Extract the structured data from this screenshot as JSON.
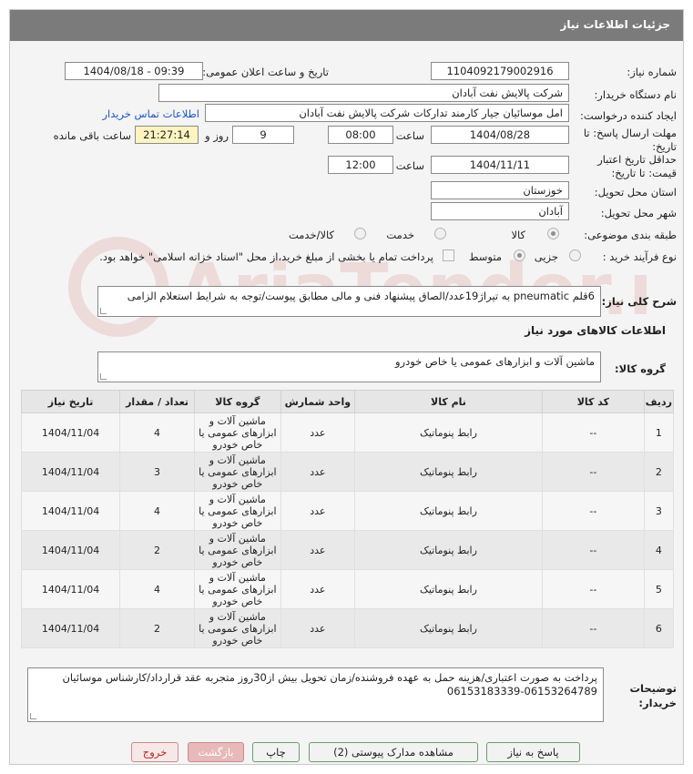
{
  "header": {
    "title": "جزئیات اطلاعات نیاز"
  },
  "form": {
    "need_number": {
      "label": "شماره نیاز:",
      "value": "1104092179002916"
    },
    "announce": {
      "label": "تاریخ و ساعت اعلان عمومی:",
      "value": "1404/08/18 - 09:39"
    },
    "buyer_org": {
      "label": "نام دستگاه خریدار:",
      "value": "شرکت پالایش نفت آبادان"
    },
    "creator": {
      "label": "ایجاد کننده درخواست:",
      "value": "امل موسائیان جیار کارمند تدارکات شرکت پالایش نفت آبادان",
      "contact_link": "اطلاعات تماس خریدار"
    },
    "deadline": {
      "label": "مهلت ارسال پاسخ: تا تاریخ:",
      "date": "1404/08/28",
      "time_label": "ساعت",
      "time": "08:00",
      "days": "9",
      "days_label": "روز و",
      "remaining": "21:27:14",
      "remaining_label": "ساعت باقی مانده"
    },
    "validity": {
      "label": "حداقل تاریخ اعتبار قیمت: تا تاریخ:",
      "date": "1404/11/11",
      "time_label": "ساعت",
      "time": "12:00"
    },
    "province": {
      "label": "استان محل تحویل:",
      "value": "خوزستان"
    },
    "city": {
      "label": "شهر محل تحویل:",
      "value": "آبادان"
    },
    "category": {
      "label": "طبقه بندی موضوعی:",
      "options": [
        "کالا",
        "خدمت",
        "کالا/خدمت"
      ]
    },
    "process": {
      "label": "نوع فرآیند خرید :",
      "options": [
        "جزیی",
        "متوسط"
      ],
      "note": "پرداخت تمام یا بخشی از مبلغ خرید،از محل \"اسناد خزانه اسلامی\" خواهد بود."
    }
  },
  "description": {
    "label": "شرح کلی نیاز:",
    "value": "6قلم pneumatic به تیراژ19عدد/الصاق پیشنهاد فنی و مالی مطابق پیوست/توجه به شرایط استعلام الزامی"
  },
  "goods_section": {
    "title": "اطلاعات کالاهای مورد نیاز",
    "group_label": "گروه کالا:",
    "group_value": "ماشین آلات و ابزارهای عمومی یا خاص خودرو"
  },
  "table": {
    "headers": [
      "ردیف",
      "کد کالا",
      "نام کالا",
      "واحد شمارش",
      "گروه کالا",
      "تعداد / مقدار",
      "تاریخ نیاز"
    ],
    "rows": [
      [
        "1",
        "--",
        "رابط پنوماتیک",
        "عدد",
        "ماشین آلات و ابزارهای عمومی یا خاص خودرو",
        "4",
        "1404/11/04"
      ],
      [
        "2",
        "--",
        "رابط پنوماتیک",
        "عدد",
        "ماشین آلات و ابزارهای عمومی یا خاص خودرو",
        "3",
        "1404/11/04"
      ],
      [
        "3",
        "--",
        "رابط پنوماتیک",
        "عدد",
        "ماشین آلات و ابزارهای عمومی یا خاص خودرو",
        "4",
        "1404/11/04"
      ],
      [
        "4",
        "--",
        "رابط پنوماتیک",
        "عدد",
        "ماشین آلات و ابزارهای عمومی یا خاص خودرو",
        "2",
        "1404/11/04"
      ],
      [
        "5",
        "--",
        "رابط پنوماتیک",
        "عدد",
        "ماشین آلات و ابزارهای عمومی یا خاص خودرو",
        "4",
        "1404/11/04"
      ],
      [
        "6",
        "--",
        "رابط پنوماتیک",
        "عدد",
        "ماشین آلات و ابزارهای عمومی یا خاص خودرو",
        "2",
        "1404/11/04"
      ]
    ]
  },
  "buyer_notes": {
    "label": "توضیحات خریدار:",
    "value": "پرداخت به صورت اعتباری/هزینه حمل به عهده فروشنده/زمان تحویل بیش از30روز متجربه عقد قرارداد/کارشناس موسائیان 06153264789-06153183339"
  },
  "buttons": {
    "reply": "پاسخ به نیاز",
    "docs": "مشاهده مدارک پیوستی (2)",
    "print": "چاپ",
    "back": "بازگشت",
    "exit": "خروج"
  },
  "watermark": {
    "text": "AriaTender.net"
  },
  "colors": {
    "title_bar": "#7b7b7b",
    "link": "#1a55c8",
    "button_border": "#6b9e6b",
    "exit_text": "#bb2222"
  }
}
